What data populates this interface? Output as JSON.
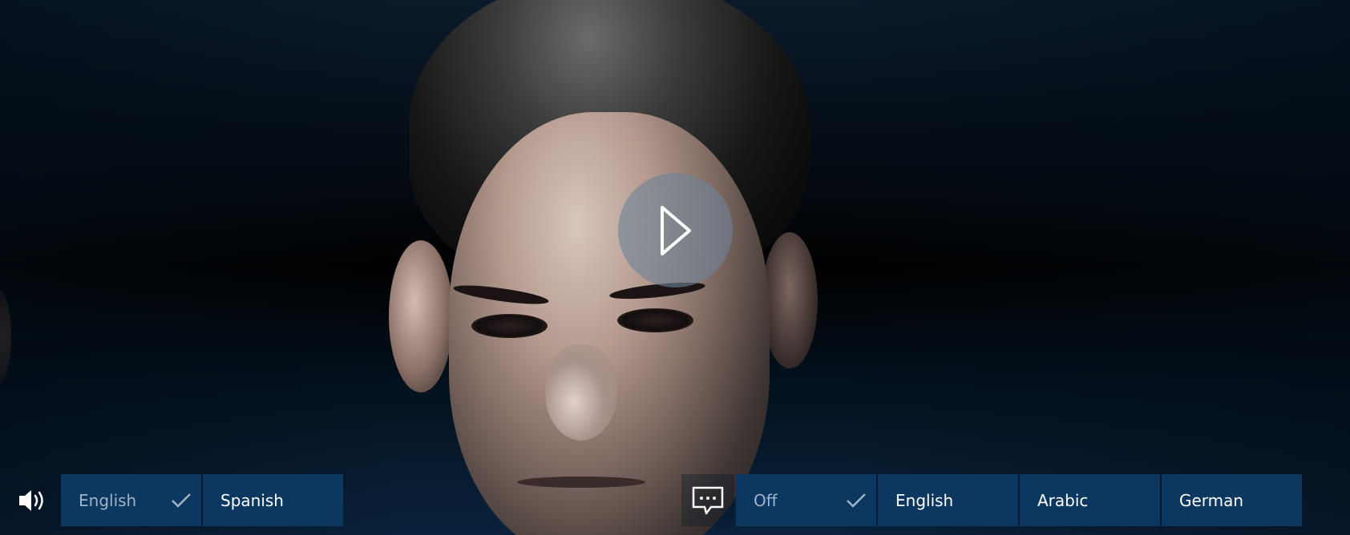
{
  "player": {
    "play_icon": "play-icon"
  },
  "audio": {
    "icon": "speaker-icon",
    "options": [
      {
        "label": "English",
        "selected": true
      },
      {
        "label": "Spanish",
        "selected": false
      }
    ]
  },
  "subtitles": {
    "icon": "subtitles-icon",
    "options": [
      {
        "label": "Off",
        "selected": true
      },
      {
        "label": "English",
        "selected": false
      },
      {
        "label": "Arabic",
        "selected": false
      },
      {
        "label": "German",
        "selected": false
      }
    ]
  },
  "colors": {
    "option_bg": "#0b3760",
    "selected_text": "#9fb4c8",
    "text": "#ffffff",
    "play_button_bg": "#6e8296"
  }
}
